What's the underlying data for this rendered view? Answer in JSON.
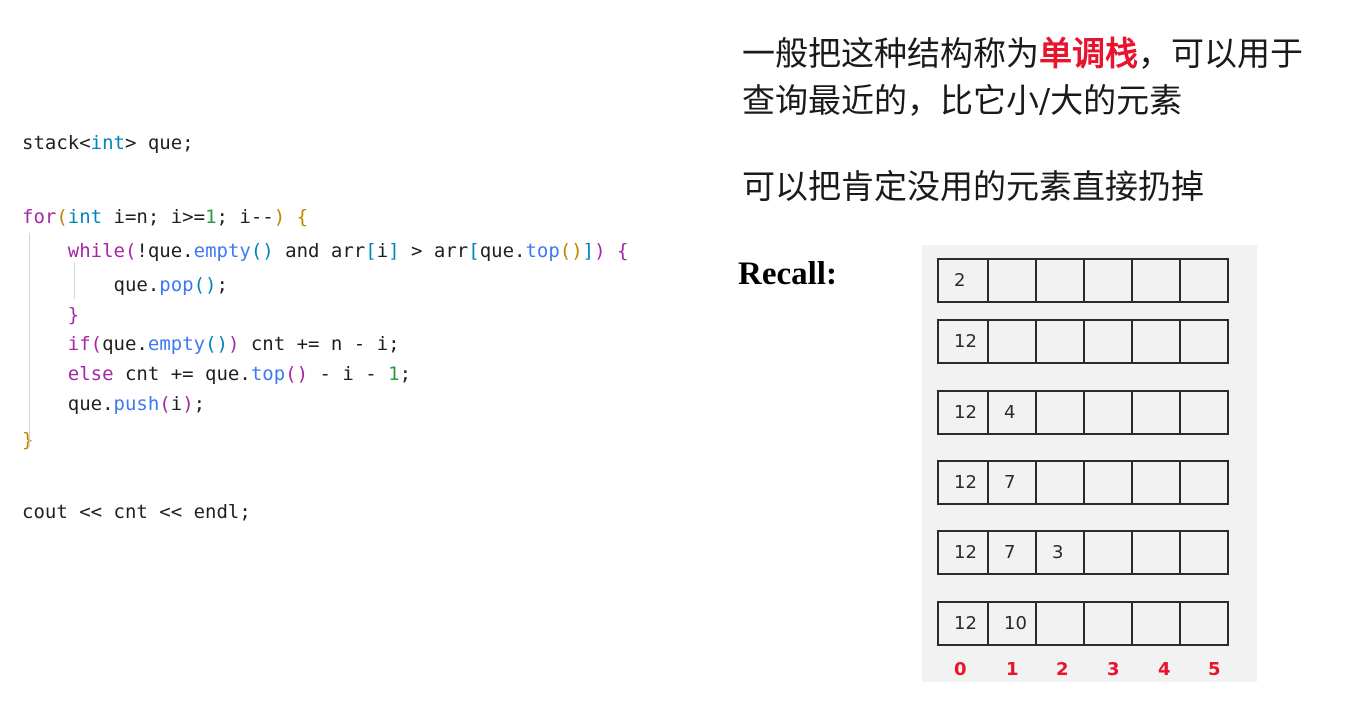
{
  "code_lines": [
    "stack<int> que;",
    "for(int i=n; i>=1; i--) {",
    "while(!que.empty() and arr[i] > arr[que.top()]) {",
    "que.pop();",
    "}",
    "if(que.empty()) cnt += n - i;",
    "else cnt += que.top() - i - 1;",
    "que.push(i);",
    "}",
    "cout << cnt << endl;"
  ],
  "notes": {
    "line1_before": "一般把这种结构称为",
    "line1_highlight": "单调栈",
    "line1_after": "，可以用于",
    "line2": "查询最近的，比它小/大的元素",
    "line3": "可以把肯定没用的元素直接扔掉"
  },
  "recall_label": "Recall:",
  "stack_rows": [
    [
      "2",
      "",
      "",
      "",
      "",
      ""
    ],
    [
      "12",
      "",
      "",
      "",
      "",
      ""
    ],
    [
      "12",
      "4",
      "",
      "",
      "",
      ""
    ],
    [
      "12",
      "7",
      "",
      "",
      "",
      ""
    ],
    [
      "12",
      "7",
      "3",
      "",
      "",
      ""
    ],
    [
      "12",
      "10",
      "",
      "",
      "",
      ""
    ]
  ],
  "indices": [
    "0",
    "1",
    "2",
    "3",
    "4",
    "5"
  ],
  "colors": {
    "highlight": "#e8132c",
    "keyword": "#a626a4",
    "type": "#0184bc",
    "number": "#2e9a3f"
  }
}
